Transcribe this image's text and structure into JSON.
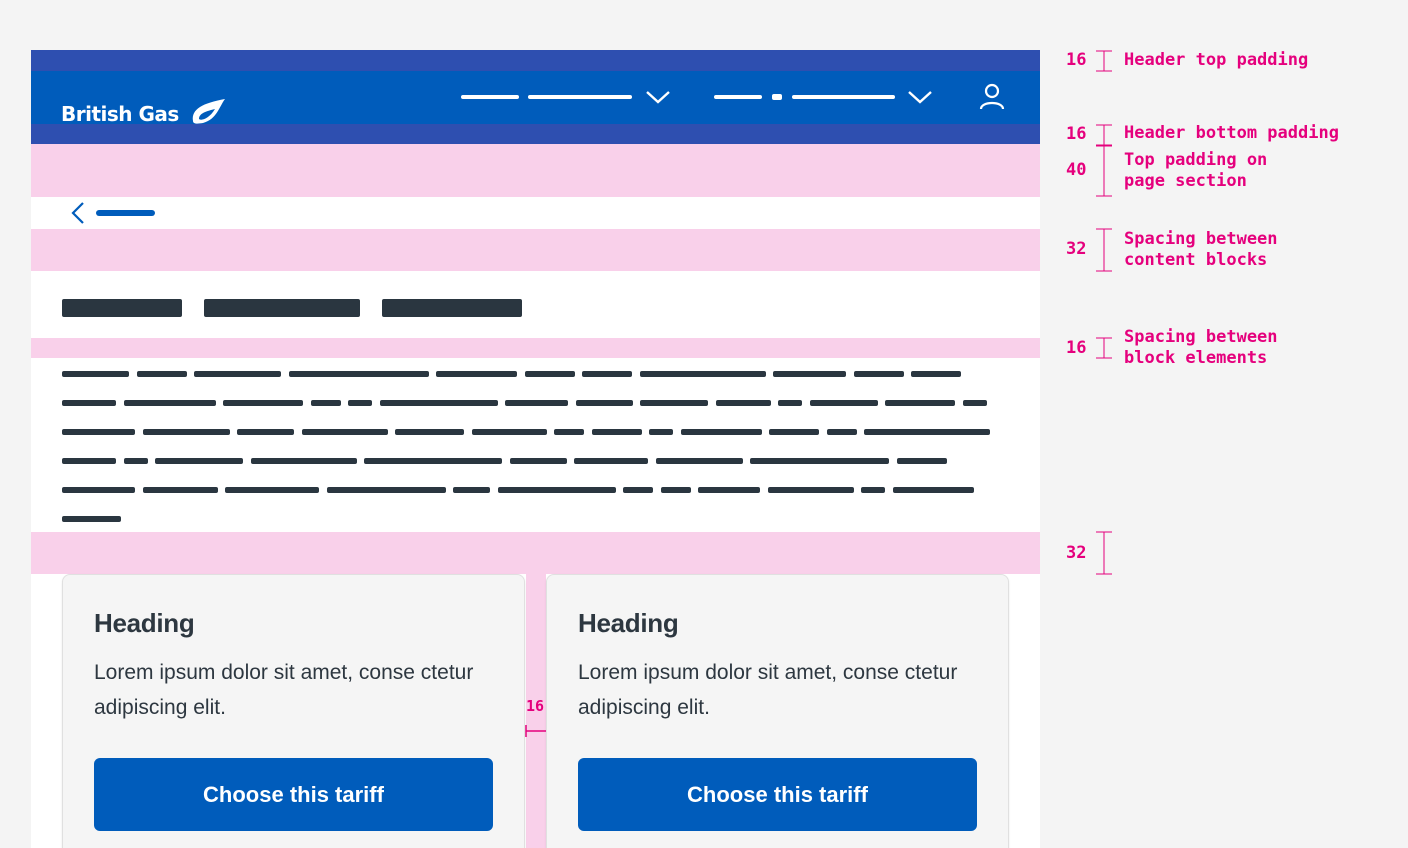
{
  "header": {
    "logo_text": "British Gas",
    "nav": [
      {
        "icon": "chevron-down-icon"
      },
      {
        "icon": "chevron-down-icon"
      }
    ],
    "account_icon": "user-icon"
  },
  "back_link": {
    "icon": "chevron-left-icon"
  },
  "cards": [
    {
      "heading": "Heading",
      "body": "Lorem ipsum dolor sit amet, conse ctetur adipiscing elit.",
      "button_label": "Choose this tariff"
    },
    {
      "heading": "Heading",
      "body": "Lorem ipsum dolor sit amet, conse ctetur adipiscing elit.",
      "button_label": "Choose this tariff"
    }
  ],
  "card_gap_label": "16",
  "annotations": [
    {
      "value": "16",
      "label": "Header top padding"
    },
    {
      "value": "16",
      "label": "Header bottom padding"
    },
    {
      "value": "40",
      "label": "Top padding on page section"
    },
    {
      "value": "32",
      "label": "Spacing between content blocks"
    },
    {
      "value": "16",
      "label": "Spacing between block elements"
    },
    {
      "value": "32",
      "label": ""
    }
  ],
  "colors": {
    "brand_blue": "#005cbb",
    "padding_blue": "#2e4fb0",
    "padding_pink": "#f9d0ea",
    "annotation_magenta": "#e5007d",
    "skeleton_dark": "#2a3640"
  }
}
